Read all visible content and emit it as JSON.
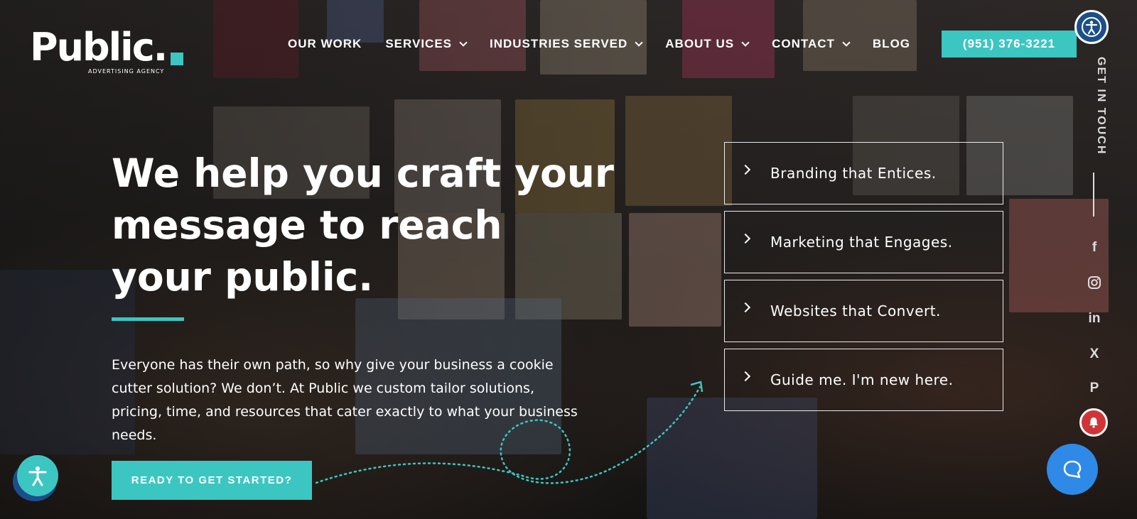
{
  "brand": {
    "logo_text": "Public.",
    "logo_sub": "ADVERTISING AGENCY",
    "accent_color": "#3cc6c1"
  },
  "nav": {
    "items": [
      {
        "label": "OUR WORK",
        "dropdown": false
      },
      {
        "label": "SERVICES",
        "dropdown": true
      },
      {
        "label": "INDUSTRIES SERVED",
        "dropdown": true
      },
      {
        "label": "ABOUT US",
        "dropdown": true
      },
      {
        "label": "CONTACT",
        "dropdown": true
      },
      {
        "label": "BLOG",
        "dropdown": false
      }
    ],
    "phone": "(951) 376-3221"
  },
  "hero": {
    "headline_lines": [
      "We help you craft your",
      "message to reach",
      "your public."
    ],
    "paragraph": "Everyone has their own path, so why give your business a cookie cutter solution?  We don’t. At Public we custom tailor solutions, pricing, time, and resources that cater exactly to what your business needs.",
    "cta_label": "READY TO GET STARTED?"
  },
  "service_boxes": [
    {
      "label": "Branding that Entices."
    },
    {
      "label": "Marketing that Engages."
    },
    {
      "label": "Websites that Convert."
    },
    {
      "label": "Guide me. I'm new here."
    }
  ],
  "sidebar": {
    "get_in_touch": "GET IN TOUCH",
    "social": [
      {
        "icon": "facebook-icon",
        "glyph": "f"
      },
      {
        "icon": "instagram-icon",
        "glyph": "◎"
      },
      {
        "icon": "linkedin-icon",
        "glyph": "in"
      },
      {
        "icon": "x-icon",
        "glyph": "X"
      },
      {
        "icon": "pinterest-icon",
        "glyph": "P"
      }
    ]
  },
  "widgets": {
    "accessibility_icon": "accessibility-icon",
    "notification_icon": "bell-icon",
    "chat_icon": "chat-icon"
  }
}
